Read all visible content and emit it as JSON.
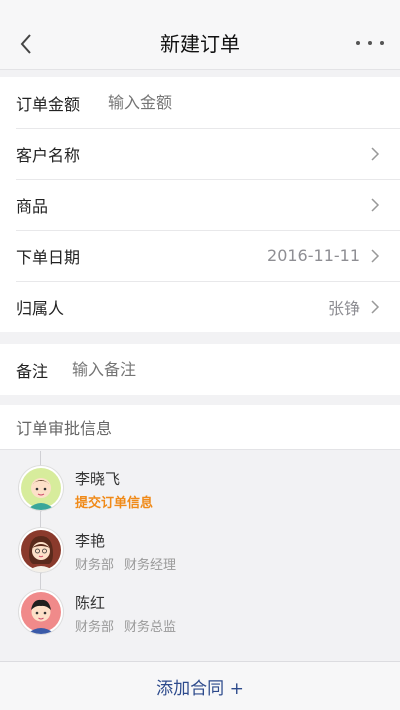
{
  "nav": {
    "title": "新建订单"
  },
  "form": {
    "amount": {
      "label": "订单金额",
      "placeholder": "输入金额"
    },
    "customer": {
      "label": "客户名称"
    },
    "product": {
      "label": "商品"
    },
    "order_date": {
      "label": "下单日期",
      "value": "2016-11-11"
    },
    "owner": {
      "label": "归属人",
      "value": "张铮"
    },
    "remark": {
      "label": "备注",
      "placeholder": "输入备注"
    }
  },
  "approval": {
    "header": "订单审批信息",
    "steps": [
      {
        "name": "李晓飞",
        "status": "提交订单信息"
      },
      {
        "name": "李艳",
        "dept": "财务部",
        "role": "财务经理"
      },
      {
        "name": "陈红",
        "dept": "财务部",
        "role": "财务总监"
      }
    ]
  },
  "footer": {
    "add_contract": "添加合同 +"
  },
  "colors": {
    "accent": "#f08a18",
    "link": "#2d4a8c"
  }
}
